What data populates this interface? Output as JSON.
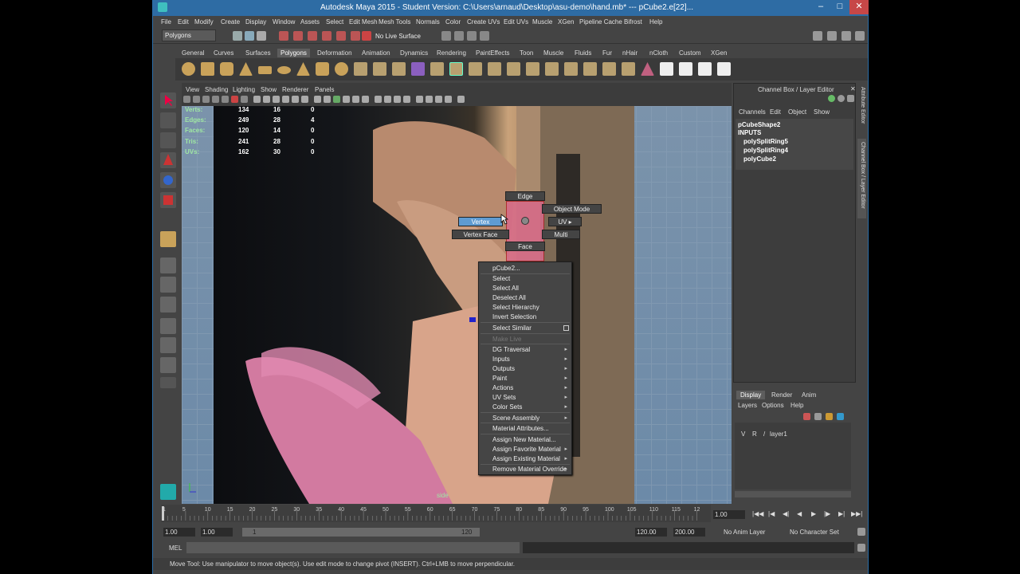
{
  "window": {
    "title": "Autodesk Maya 2015 - Student Version: C:\\Users\\arnaud\\Desktop\\asu-demo\\hand.mb*   ---   pCube2.e[22]..."
  },
  "menu": [
    "File",
    "Edit",
    "Modify",
    "Create",
    "Display",
    "Window",
    "Assets",
    "Select",
    "Edit Mesh",
    "Mesh Tools",
    "Normals",
    "Color",
    "Create UVs",
    "Edit UVs",
    "Muscle",
    "XGen",
    "Pipeline Cache",
    "Bifrost",
    "Help"
  ],
  "status": {
    "menuset": "Polygons",
    "live_surface": "No Live Surface"
  },
  "shelf_tabs": [
    "General",
    "Curves",
    "Surfaces",
    "Polygons",
    "Deformation",
    "Animation",
    "Dynamics",
    "Rendering",
    "PaintEffects",
    "Toon",
    "Muscle",
    "Fluids",
    "Fur",
    "nHair",
    "nCloth",
    "Custom",
    "XGen"
  ],
  "shelf_active": "Polygons",
  "panel_menu": [
    "View",
    "Shading",
    "Lighting",
    "Show",
    "Renderer",
    "Panels"
  ],
  "hud": {
    "labels": [
      "Verts:",
      "Edges:",
      "Faces:",
      "Tris:",
      "UVs:"
    ],
    "col1": [
      "134",
      "249",
      "120",
      "241",
      "162"
    ],
    "col2": [
      "16",
      "28",
      "14",
      "28",
      "30"
    ],
    "col3": [
      "0",
      "4",
      "0",
      "0",
      "0"
    ]
  },
  "camera_label": "side",
  "marking_menu": {
    "edge": "Edge",
    "object_mode": "Object Mode",
    "vertex": "Vertex",
    "uv": "UV",
    "vertex_face": "Vertex Face",
    "multi": "Multi",
    "face": "Face"
  },
  "context_menu": {
    "header": "pCube2...",
    "items": [
      "Select",
      "Select All",
      "Deselect All",
      "Select Hierarchy",
      "Invert Selection",
      "Select Similar",
      "Make Live",
      "DG Traversal",
      "Inputs",
      "Outputs",
      "Paint",
      "Actions",
      "UV Sets",
      "Color Sets",
      "Scene Assembly",
      "Material Attributes...",
      "Assign New Material...",
      "Assign Favorite Material",
      "Assign Existing Material",
      "Remove Material Override"
    ]
  },
  "channel_box": {
    "title": "Channel Box / Layer Editor",
    "menus": [
      "Channels",
      "Edit",
      "Object",
      "Show"
    ],
    "shape": "pCubeShape2",
    "inputs_label": "INPUTS",
    "inputs": [
      "polySplitRing5",
      "polySplitRing4",
      "polyCube2"
    ]
  },
  "side_tabs": {
    "attribute_editor": "Attribute Editor",
    "channel_box": "Channel Box / Layer Editor"
  },
  "layer_editor": {
    "tabs": [
      "Display",
      "Render",
      "Anim"
    ],
    "menus": [
      "Layers",
      "Options",
      "Help"
    ],
    "layer": {
      "v": "V",
      "r": "R",
      "name": "layer1"
    }
  },
  "timeline": {
    "ticks": [
      "1",
      "5",
      "10",
      "15",
      "20",
      "25",
      "30",
      "35",
      "40",
      "45",
      "50",
      "55",
      "60",
      "65",
      "70",
      "75",
      "80",
      "85",
      "90",
      "95",
      "100",
      "105",
      "110",
      "115",
      "12"
    ],
    "current": "1.00"
  },
  "range": {
    "start": "1.00",
    "start2": "1.00",
    "slider_start": "1",
    "slider_end": "120",
    "end": "120.00",
    "end2": "200.00",
    "anim_layer": "No Anim Layer",
    "character_set": "No Character Set"
  },
  "cmd": {
    "lang": "MEL"
  },
  "help_line": "Move Tool: Use manipulator to move object(s). Use edit mode to change pivot (INSERT). Ctrl+LMB to move perpendicular."
}
